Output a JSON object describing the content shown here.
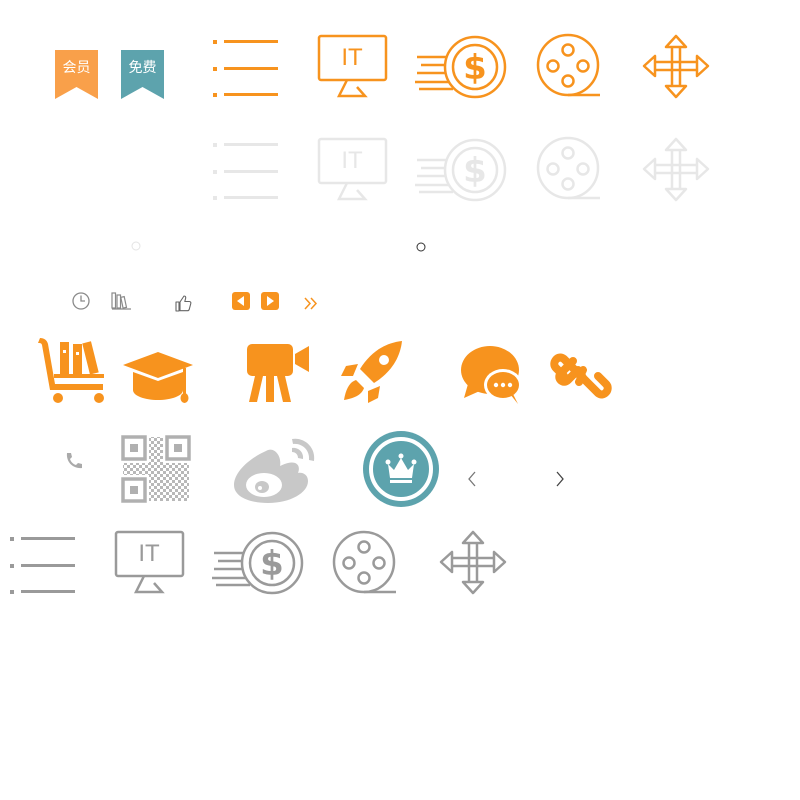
{
  "colors": {
    "orange": "#f7931e",
    "teal": "#5da3ad",
    "gray": "#9a9a9a",
    "light_gray": "#c8c8c8",
    "dark_line": "#333333",
    "ribbon_orange": "#f9a04a"
  },
  "badges": {
    "member": "会员",
    "free": "免费"
  },
  "monitor_text": {
    "orange": "IT",
    "faded": "IT",
    "gray": "IT"
  },
  "coin_symbol": {
    "orange": "$",
    "faded": "$",
    "gray": "$"
  },
  "icons": {
    "row_orange": [
      "list-icon",
      "monitor-it-icon",
      "fast-coin-icon",
      "film-reel-icon",
      "move-arrows-icon"
    ],
    "row_faded": [
      "list-icon",
      "monitor-it-icon",
      "fast-coin-icon",
      "film-reel-icon",
      "move-arrows-icon"
    ],
    "small_row": [
      "clock-icon",
      "books-icon",
      "thumbs-up-icon",
      "arrow-left-square-icon",
      "arrow-right-square-icon",
      "double-chevron-right-icon"
    ],
    "big_orange_row": [
      "book-cart-icon",
      "graduation-cap-icon",
      "video-camera-icon",
      "rocket-icon",
      "chat-bubbles-icon",
      "link-icon"
    ],
    "misc_row": [
      "phone-icon",
      "qr-code-icon",
      "weibo-icon",
      "crown-badge-icon",
      "chevron-left-icon",
      "chevron-right-icon"
    ],
    "row_gray": [
      "list-icon",
      "monitor-it-icon",
      "fast-coin-icon",
      "film-reel-icon",
      "move-arrows-icon"
    ]
  }
}
